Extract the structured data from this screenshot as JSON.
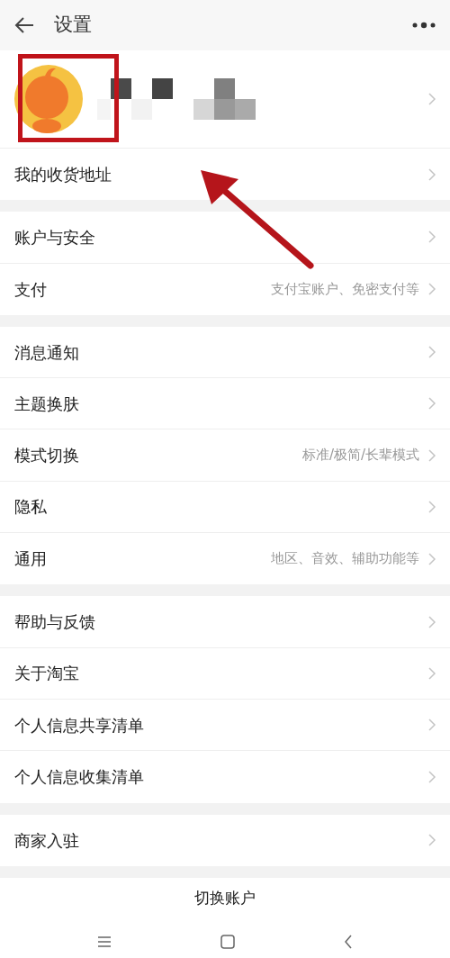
{
  "header": {
    "title": "设置"
  },
  "groups": [
    {
      "items": [
        {
          "label": "我的收货地址"
        }
      ]
    },
    {
      "items": [
        {
          "label": "账户与安全"
        },
        {
          "label": "支付",
          "hint": "支付宝账户、免密支付等"
        }
      ]
    },
    {
      "items": [
        {
          "label": "消息通知"
        },
        {
          "label": "主题换肤"
        },
        {
          "label": "模式切换",
          "hint": "标准/极简/长辈模式"
        },
        {
          "label": "隐私"
        },
        {
          "label": "通用",
          "hint": "地区、音效、辅助功能等"
        }
      ]
    },
    {
      "items": [
        {
          "label": "帮助与反馈"
        },
        {
          "label": "关于淘宝"
        },
        {
          "label": "个人信息共享清单"
        },
        {
          "label": "个人信息收集清单"
        }
      ]
    },
    {
      "items": [
        {
          "label": "商家入驻"
        }
      ]
    }
  ],
  "switch_account": {
    "label": "切换账户"
  }
}
